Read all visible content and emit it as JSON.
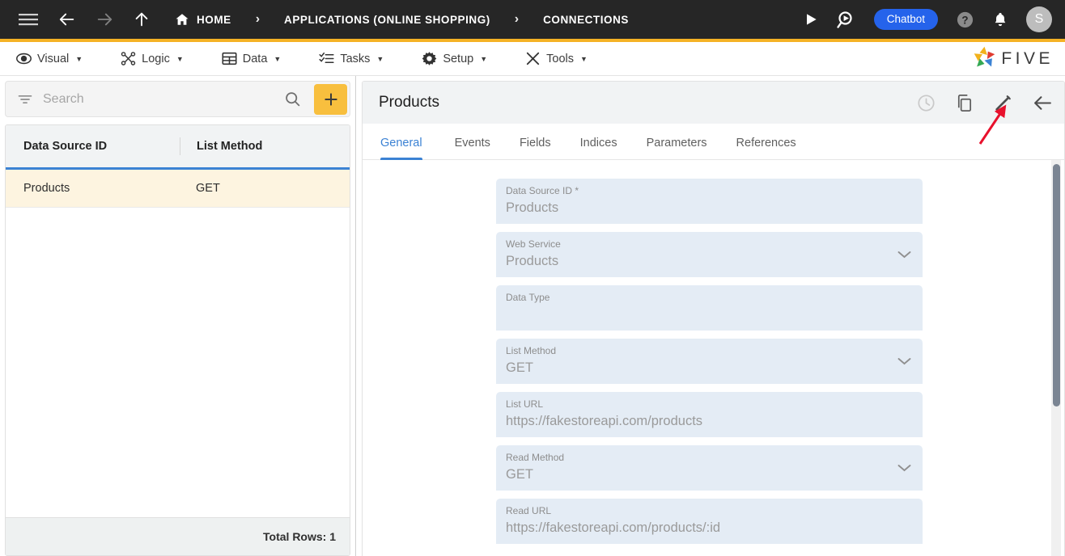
{
  "topbar": {
    "icons": {
      "menu": "hamburger-icon",
      "back": "back-arrow-icon",
      "forward": "forward-arrow-icon",
      "up": "up-arrow-icon",
      "home": "home-icon"
    },
    "breadcrumbs": [
      {
        "label": "HOME",
        "icon": "home-icon"
      },
      {
        "label": "APPLICATIONS (ONLINE SHOPPING)"
      },
      {
        "label": "CONNECTIONS"
      }
    ],
    "separator": "›",
    "actions": {
      "run_label": "run-icon",
      "search_run_label": "search-run-icon",
      "chatbot_label": "Chatbot",
      "help_label": "help-icon",
      "notifications_label": "bell-icon",
      "avatar_initial": "S"
    },
    "colors": {
      "background": "#262626",
      "accent_underline": "#f5b225",
      "chatbot_blue": "#2563eb"
    }
  },
  "menubar": {
    "items": [
      {
        "label": "Visual",
        "icon": "eye-icon"
      },
      {
        "label": "Logic",
        "icon": "logic-nodes-icon"
      },
      {
        "label": "Data",
        "icon": "table-icon"
      },
      {
        "label": "Tasks",
        "icon": "checklist-icon"
      },
      {
        "label": "Setup",
        "icon": "gear-icon"
      },
      {
        "label": "Tools",
        "icon": "tools-icon"
      }
    ],
    "caret": "▼",
    "brand": "FIVE"
  },
  "sidebar": {
    "search": {
      "placeholder": "Search",
      "value": "",
      "filter_icon": "filter-icon",
      "search_icon": "search-icon",
      "add_label": "+"
    },
    "table": {
      "columns": [
        "Data Source ID",
        "List Method"
      ],
      "rows": [
        {
          "data_source_id": "Products",
          "list_method": "GET",
          "selected": true
        }
      ],
      "footer": "Total Rows: 1"
    },
    "colors": {
      "header_bg": "#f1f3f4",
      "selected_row_bg": "#fdf4e0",
      "accent_rule": "#3b82d4",
      "add_button": "#f8bf3e"
    }
  },
  "main": {
    "title": "Products",
    "actions": [
      {
        "name": "history-icon",
        "disabled": true
      },
      {
        "name": "copy-icon",
        "disabled": false
      },
      {
        "name": "edit-pencil-icon",
        "disabled": false
      },
      {
        "name": "back-arrow-icon",
        "disabled": false
      }
    ],
    "tabs": [
      {
        "label": "General",
        "active": true
      },
      {
        "label": "Events",
        "active": false
      },
      {
        "label": "Fields",
        "active": false
      },
      {
        "label": "Indices",
        "active": false
      },
      {
        "label": "Parameters",
        "active": false
      },
      {
        "label": "References",
        "active": false
      }
    ],
    "form": {
      "fields": [
        {
          "label": "Data Source ID *",
          "value": "Products",
          "type": "text"
        },
        {
          "label": "Web Service",
          "value": "Products",
          "type": "select"
        },
        {
          "label": "Data Type",
          "value": "",
          "type": "text"
        },
        {
          "label": "List Method",
          "value": "GET",
          "type": "select"
        },
        {
          "label": "List URL",
          "value": "https://fakestoreapi.com/products",
          "type": "text"
        },
        {
          "label": "Read Method",
          "value": "GET",
          "type": "select"
        },
        {
          "label": "Read URL",
          "value": "https://fakestoreapi.com/products/:id",
          "type": "text"
        }
      ]
    },
    "colors": {
      "field_bg": "#e4ecf5",
      "active_tab": "#3b82d4",
      "annotation_arrow": "#e8112d"
    }
  }
}
